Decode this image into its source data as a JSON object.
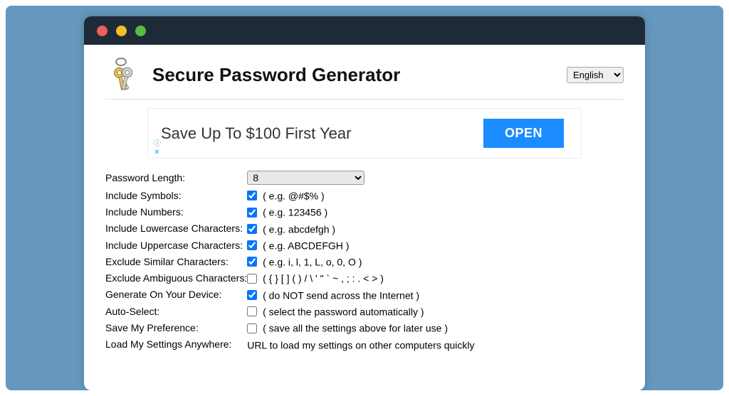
{
  "header": {
    "title": "Secure Password Generator",
    "language": "English"
  },
  "ad": {
    "text": "Save Up To $100 First Year",
    "button": "OPEN",
    "info_icon": "ⓘ",
    "close_icon": "✕"
  },
  "options": {
    "password_length": {
      "label": "Password Length:",
      "value": "8"
    },
    "include_symbols": {
      "label": "Include Symbols:",
      "hint": "( e.g. @#$% )",
      "checked": true
    },
    "include_numbers": {
      "label": "Include Numbers:",
      "hint": "( e.g. 123456 )",
      "checked": true
    },
    "include_lowercase": {
      "label": "Include Lowercase Characters:",
      "hint": "( e.g. abcdefgh )",
      "checked": true
    },
    "include_uppercase": {
      "label": "Include Uppercase Characters:",
      "hint": "( e.g. ABCDEFGH )",
      "checked": true
    },
    "exclude_similar": {
      "label": "Exclude Similar Characters:",
      "hint": "( e.g. i, l, 1, L, o, 0, O )",
      "checked": true
    },
    "exclude_ambiguous": {
      "label": "Exclude Ambiguous Characters:",
      "hint": "( { } [ ] ( ) / \\ ' \" ` ~ , ; : . < > )",
      "checked": false
    },
    "generate_on_device": {
      "label": "Generate On Your Device:",
      "hint": "( do NOT send across the Internet )",
      "checked": true
    },
    "auto_select": {
      "label": "Auto-Select:",
      "hint": "( select the password automatically )",
      "checked": false
    },
    "save_preference": {
      "label": "Save My Preference:",
      "hint": "( save all the settings above for later use )",
      "checked": false
    },
    "load_anywhere": {
      "label": "Load My Settings Anywhere:",
      "hint": "URL to load my settings on other computers quickly"
    }
  }
}
